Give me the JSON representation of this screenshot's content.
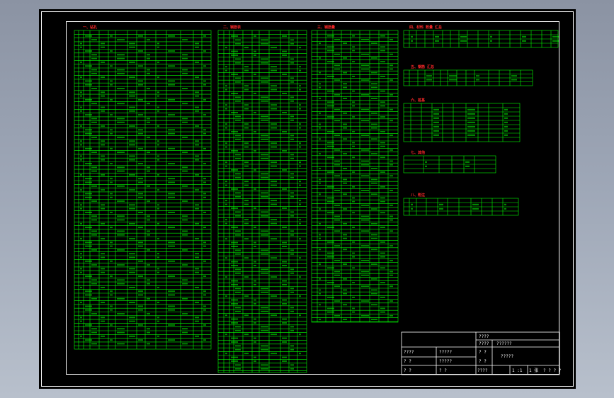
{
  "colors": {
    "line": "#00ff00",
    "title": "#ff2a2a",
    "frame": "#ffffff",
    "bg": "#000000"
  },
  "sections": [
    {
      "id": "s1",
      "title": "一、钻孔"
    },
    {
      "id": "s2",
      "title": "二、钢筋表"
    },
    {
      "id": "s3",
      "title": "三、钢筋量"
    },
    {
      "id": "s4",
      "title": "四、材料 数量 汇总"
    },
    {
      "id": "s5",
      "title": "五、钢筋 汇总"
    },
    {
      "id": "s6",
      "title": "六、桩基"
    },
    {
      "id": "s7",
      "title": "七、其他"
    },
    {
      "id": "s8",
      "title": "八、附注"
    }
  ],
  "title_block": {
    "r1": "????",
    "r2a": "????",
    "r2b": "??????",
    "r3a": "????",
    "r3b": "?????",
    "r3c": "? ?",
    "r3d": "?????",
    "r4a": "?  ?",
    "r4b": "?????",
    "r4c": "? ?",
    "r5a": "?  ?",
    "r5b": "?  ?",
    "r5c": "????",
    "r5d": "1 :1",
    "r5e": "1 张",
    "r5f": "? ? ? ?"
  }
}
